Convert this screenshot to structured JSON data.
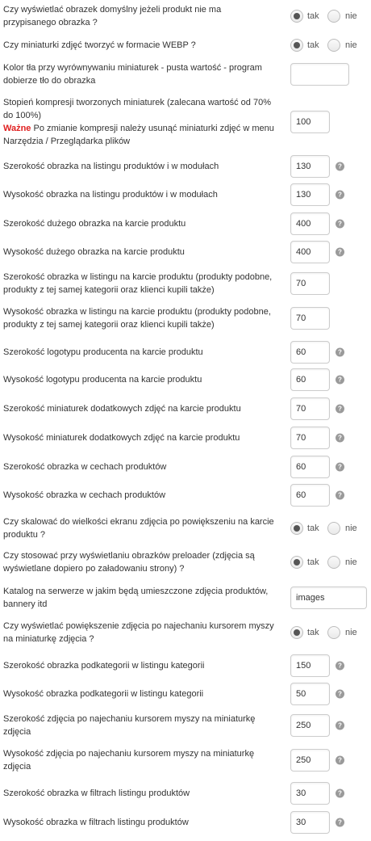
{
  "radio_settings": [
    {
      "label": "Czy wyświetlać obrazek domyślny jeżeli produkt nie ma przypisanego obrazka ?",
      "yes": "tak",
      "no": "nie",
      "selected": "tak"
    },
    {
      "label": "Czy miniaturki zdjęć tworzyć w formacie WEBP ?",
      "yes": "tak",
      "no": "nie",
      "selected": "tak"
    },
    {
      "label": "Czy skalować do wielkości ekranu zdjęcia po powiększeniu na karcie produktu ?",
      "yes": "tak",
      "no": "nie",
      "selected": "tak"
    },
    {
      "label": "Czy stosować przy wyświetlaniu obrazków preloader (zdjęcia są wyświetlane dopiero po załadowaniu strony) ?",
      "yes": "tak",
      "no": "nie",
      "selected": "tak"
    },
    {
      "label": "Czy wyświetlać powiększenie zdjęcia po najechaniu kursorem myszy na miniaturkę zdjęcia ?",
      "yes": "tak",
      "no": "nie",
      "selected": "tak"
    }
  ],
  "bg_color": {
    "label": "Kolor tła przy wyrównywaniu miniaturek - pusta wartość - program dobierze tło do obrazka",
    "value": ""
  },
  "compression": {
    "label": "Stopień kompresji tworzonych miniaturek (zalecana wartość od 70% do 100%)",
    "warning_word": "Ważne",
    "warning_text": " Po zmianie kompresji należy usunąć miniaturki zdjęć w menu Narzędzia / Przeglądarka plików",
    "value": "100"
  },
  "catalog": {
    "label": "Katalog na serwerze w jakim będą umieszczone zdjęcia produktów, bannery itd",
    "value": "images"
  },
  "size_settings": [
    {
      "label": "Szerokość obrazka na listingu produktów i w modułach",
      "value": "130",
      "help": "?"
    },
    {
      "label": "Wysokość obrazka na listingu produktów i w modułach",
      "value": "130",
      "help": "?"
    },
    {
      "label": "Szerokość dużego obrazka na karcie produktu",
      "value": "400",
      "help": "?"
    },
    {
      "label": "Wysokość dużego obrazka na karcie produktu",
      "value": "400",
      "help": "?"
    },
    {
      "label": "Szerokość obrazka w listingu na karcie produktu (produkty podobne, produkty z tej samej kategorii oraz klienci kupili także)",
      "value": "70",
      "help": ""
    },
    {
      "label": "Wysokość obrazka w listingu na karcie produktu (produkty podobne, produkty z tej samej kategorii oraz klienci kupili także)",
      "value": "70",
      "help": ""
    },
    {
      "label": "Szerokość logotypu producenta na karcie produktu",
      "value": "60",
      "help": "?"
    },
    {
      "label": "Wysokość logotypu producenta na karcie produktu",
      "value": "60",
      "help": "?"
    },
    {
      "label": "Szerokość miniaturek dodatkowych zdjęć na karcie produktu",
      "value": "70",
      "help": "?"
    },
    {
      "label": "Wysokość miniaturek dodatkowych zdjęć na karcie produktu",
      "value": "70",
      "help": "?"
    },
    {
      "label": "Szerokość obrazka w cechach produktów",
      "value": "60",
      "help": "?"
    },
    {
      "label": "Wysokość obrazka w cechach produktów",
      "value": "60",
      "help": "?"
    },
    {
      "label": "Szerokość obrazka podkategorii w listingu kategorii",
      "value": "150",
      "help": "?"
    },
    {
      "label": "Wysokość obrazka podkategorii w listingu kategorii",
      "value": "50",
      "help": "?"
    },
    {
      "label": "Szerokość zdjęcia po najechaniu kursorem myszy na miniaturkę zdjęcia",
      "value": "250",
      "help": "?"
    },
    {
      "label": "Wysokość zdjęcia po najechaniu kursorem myszy na miniaturkę zdjęcia",
      "value": "250",
      "help": "?"
    },
    {
      "label": "Szerokość obrazka w filtrach listingu produktów",
      "value": "30",
      "help": "?"
    },
    {
      "label": "Wysokość obrazka w filtrach listingu produktów",
      "value": "30",
      "help": "?"
    }
  ]
}
